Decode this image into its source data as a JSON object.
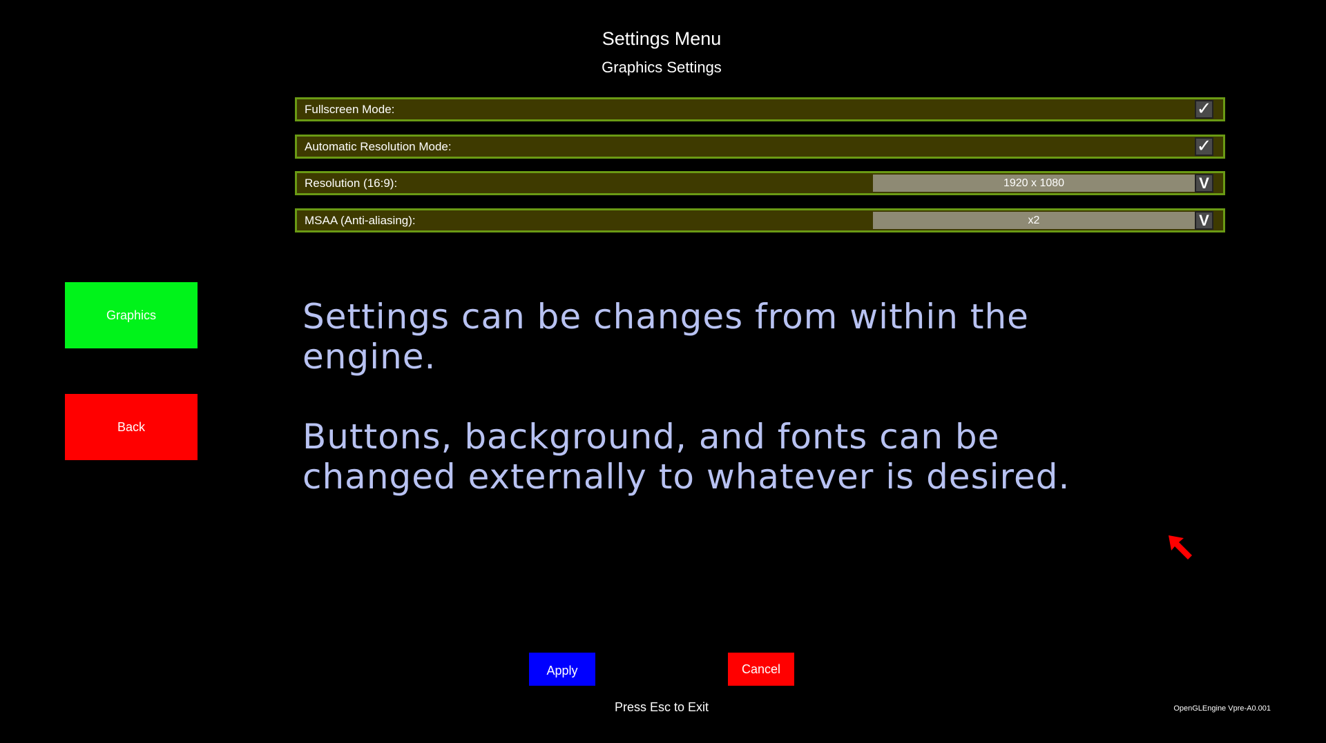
{
  "header": {
    "title": "Settings Menu",
    "subtitle": "Graphics Settings"
  },
  "settings": [
    {
      "label": "Fullscreen Mode:",
      "control": "checkbox",
      "checked": true
    },
    {
      "label": "Automatic Resolution Mode:",
      "control": "checkbox",
      "checked": true
    },
    {
      "label": "Resolution (16:9):",
      "control": "dropdown",
      "value": "1920 x 1080"
    },
    {
      "label": "MSAA (Anti-aliasing):",
      "control": "dropdown",
      "value": "x2"
    }
  ],
  "sidebar": {
    "graphics_label": "Graphics",
    "back_label": "Back"
  },
  "info": {
    "paragraph_1": "Settings can be changes from within the engine.",
    "paragraph_2": "Buttons, background, and fonts can be changed externally to whatever is desired."
  },
  "footer": {
    "apply_label": "Apply",
    "cancel_label": "Cancel",
    "hint": "Press Esc to Exit",
    "version": "OpenGLEngine Vpre-A0.001"
  },
  "glyphs": {
    "checkmark": "✓",
    "dropdown_arrow": "V"
  },
  "icons": {
    "cursor": "mouse-cursor-icon"
  },
  "colors": {
    "background": "#000000",
    "row_fill": "#3e3a00",
    "row_border": "#6a9a14",
    "dropdown_fill": "#8e8a74",
    "graphics_button": "#00f31a",
    "back_button": "#ff0000",
    "apply_button": "#0000ff",
    "cancel_button": "#ff0000",
    "info_text": "#b8c2f2",
    "cursor": "#ff0000"
  }
}
